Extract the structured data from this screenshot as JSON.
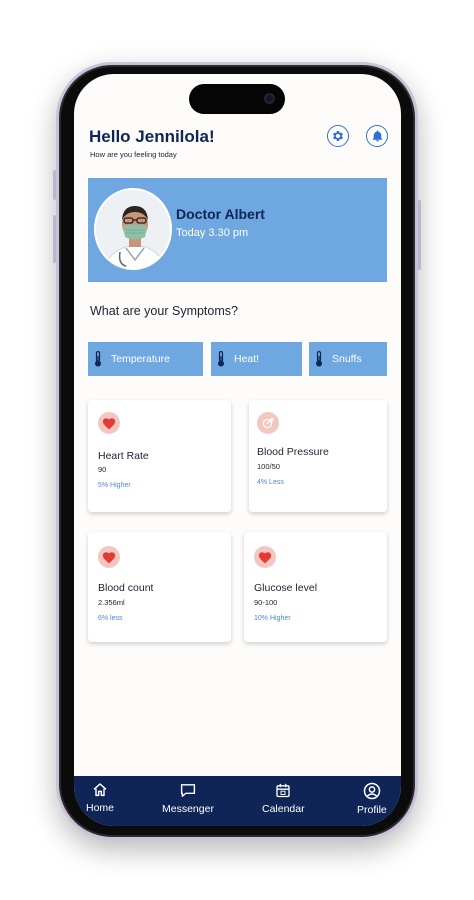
{
  "header": {
    "greeting": "Hello Jennilola!",
    "subtitle": "How are you feeling today"
  },
  "icons": {
    "settings": "gear-icon",
    "notifications": "bell-icon"
  },
  "doctor": {
    "name": "Doctor Albert",
    "time": "Today 3.30 pm"
  },
  "symptoms": {
    "title": "What are your Symptoms?",
    "chips": [
      {
        "label": "Temperature"
      },
      {
        "label": "Heat!"
      },
      {
        "label": "Snuffs"
      }
    ]
  },
  "metrics": [
    {
      "title": "Heart Rate",
      "value": "90",
      "change": "5% Higher",
      "icon": "heart-icon"
    },
    {
      "title": "Blood Pressure",
      "value": "100/50",
      "change": "4% Less",
      "icon": "pressure-icon"
    },
    {
      "title": "Blood count",
      "value": "2.356ml",
      "change": "6% less",
      "icon": "heart-icon"
    },
    {
      "title": "Glucose level",
      "value": "90-100",
      "change": "10% Higher",
      "icon": "heart-icon"
    }
  ],
  "nav": [
    {
      "label": "Home",
      "icon": "home-icon"
    },
    {
      "label": "Messenger",
      "icon": "chat-icon"
    },
    {
      "label": "Calendar",
      "icon": "calendar-icon"
    },
    {
      "label": "Profile",
      "icon": "profile-icon"
    }
  ],
  "colors": {
    "primary": "#0f2557",
    "accent": "#6fa7e0",
    "link": "#4f86d1",
    "heart": "#e53935"
  }
}
